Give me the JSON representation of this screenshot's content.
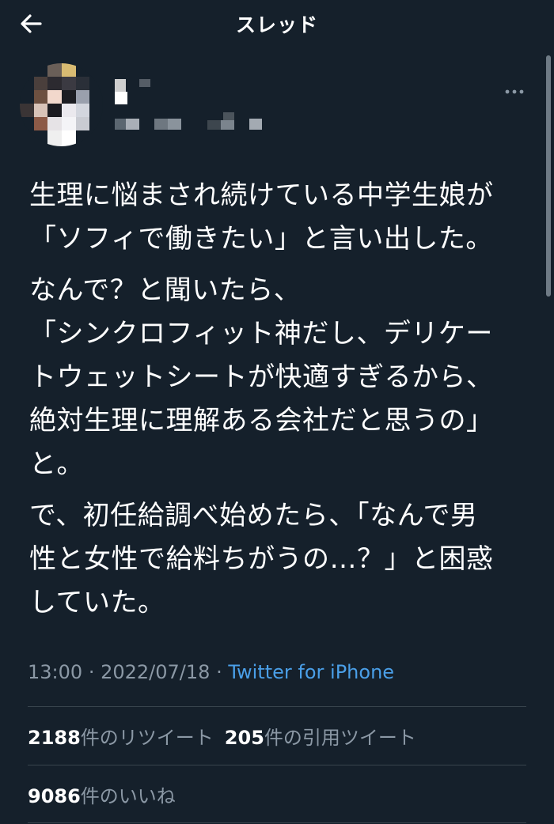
{
  "header": {
    "title": "スレッド",
    "back_icon": "arrow-left-icon"
  },
  "author": {
    "avatar": "pixelated-avatar",
    "more_icon": "more-horizontal-icon"
  },
  "tweet": {
    "paragraphs": [
      "生理に悩まされ続けている中学生娘が\n「ソフィで働きたい」と言い出した。",
      "なんで？と聞いたら、\n「シンクロフィット神だし、デリケー\nトウェットシートが快適すぎるから、\n絶対生理に理解ある会社だと思うの」\nと。",
      "で、初任給調べ始めたら、「なんで男\n性と女性で給料ちがうの…？」と困惑\nしていた。"
    ],
    "time": "13:00",
    "separator": "·",
    "date": "2022/07/18",
    "source": "Twitter for iPhone"
  },
  "stats": {
    "retweets": {
      "count": "2188",
      "label": "件のリツイート"
    },
    "quotes": {
      "count": "205",
      "label": "件の引用ツイート"
    },
    "likes": {
      "count": "9086",
      "label": "件のいいね"
    }
  },
  "colors": {
    "background": "#15202b",
    "text": "#ffffff",
    "secondary": "#8b98a5",
    "link": "#4a9fe8",
    "divider": "#38444d"
  }
}
